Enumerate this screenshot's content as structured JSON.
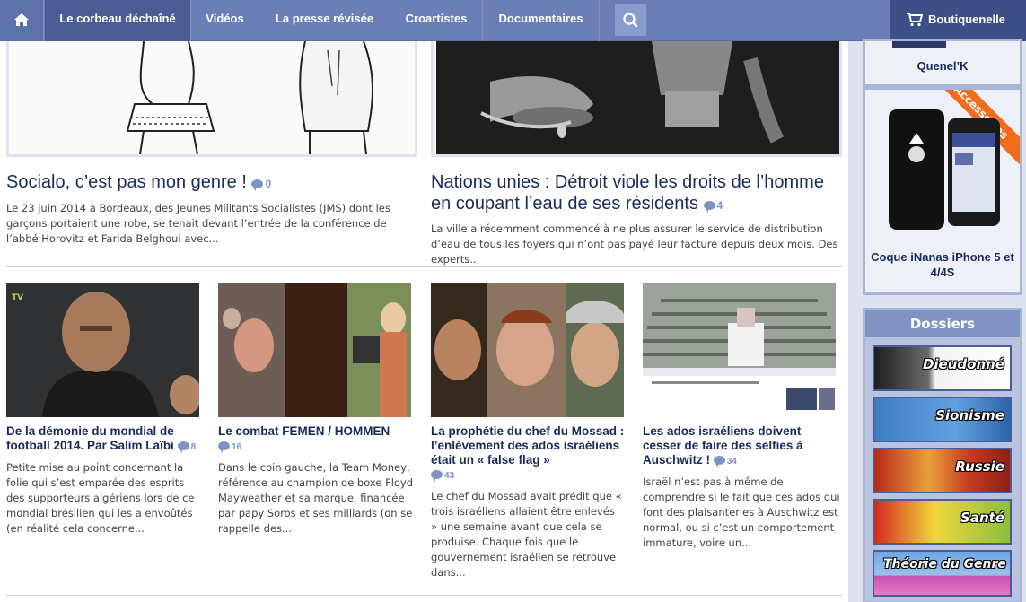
{
  "nav": {
    "items": [
      "Le corbeau déchaîné",
      "Vidéos",
      "La presse révisée",
      "Croartistes",
      "Documentaires"
    ],
    "shop_label": "Boutiquenelle",
    "icons": {
      "home": "home-icon",
      "search": "search-icon",
      "cart": "cart-icon"
    }
  },
  "featured": [
    {
      "title": "Socialo, c’est pas mon genre !",
      "comments": "0",
      "excerpt": "Le 23 juin 2014 à Bordeaux, des Jeunes Militants Socialistes (JMS) dont les garçons portaient une robe, se tenait devant l’entrée de la conférence de l’abbé Horovitz et Farida Belghoul avec..."
    },
    {
      "title": "Nations unies : Détroit viole les droits de l’homme en coupant l’eau de ses résidents",
      "comments": "4",
      "excerpt": "La ville a récemment commencé à ne plus assurer le service de distribution d’eau de tous les foyers qui n’ont pas payé leur facture depuis deux mois. Des experts..."
    }
  ],
  "articles": [
    {
      "title": "De la démonie du mondial de football 2014. Par Salim Laïbi",
      "comments": "8",
      "excerpt": "Petite mise au point concernant la folie qui s’est emparée des esprits des supporteurs algériens lors de ce mondial brésilien qui les a envoûtés (en réalité cela concerne...",
      "badge": "TV"
    },
    {
      "title": "Le combat FEMEN / HOMMEN",
      "comments": "16",
      "excerpt": "Dans le coin gauche, la Team Money, référence au champion de boxe Floyd Mayweather et sa marque, financée par papy Soros et ses milliards (on se rappelle des..."
    },
    {
      "title": "La prophétie du chef du Mossad : l’enlèvement des ados israéliens était un « false flag »",
      "comments": "43",
      "excerpt": "Le chef du Mossad avait prédit que « trois israéliens allaient être enlevés » une semaine avant que cela se produise. Chaque fois que le gouvernement israélien se retrouve dans..."
    },
    {
      "title": "Les ados israéliens doivent cesser de faire des selfies à Auschwitz !",
      "comments": "34",
      "excerpt": "Israël n’est pas à même de comprendre si le fait que ces ados qui font des plaisanteries à Auschwitz est normal, ou si c’est un comportement immature, voire un..."
    }
  ],
  "sidebar": {
    "top_caption": "Quenel’K",
    "product_caption": "Coque iNanas iPhone 5 et 4/4S",
    "ribbon": "Accessoires",
    "dossiers_title": "Dossiers",
    "dossiers": [
      "Dieudonné",
      "Sionisme",
      "Russie",
      "Santé",
      "Théorie du Genre"
    ]
  },
  "colors": {
    "nav": "#6a7fb6",
    "nav_active": "#4a5d94",
    "title": "#1a2a5c",
    "accent": "#7f93c3",
    "ribbon": "#f36d1e"
  }
}
